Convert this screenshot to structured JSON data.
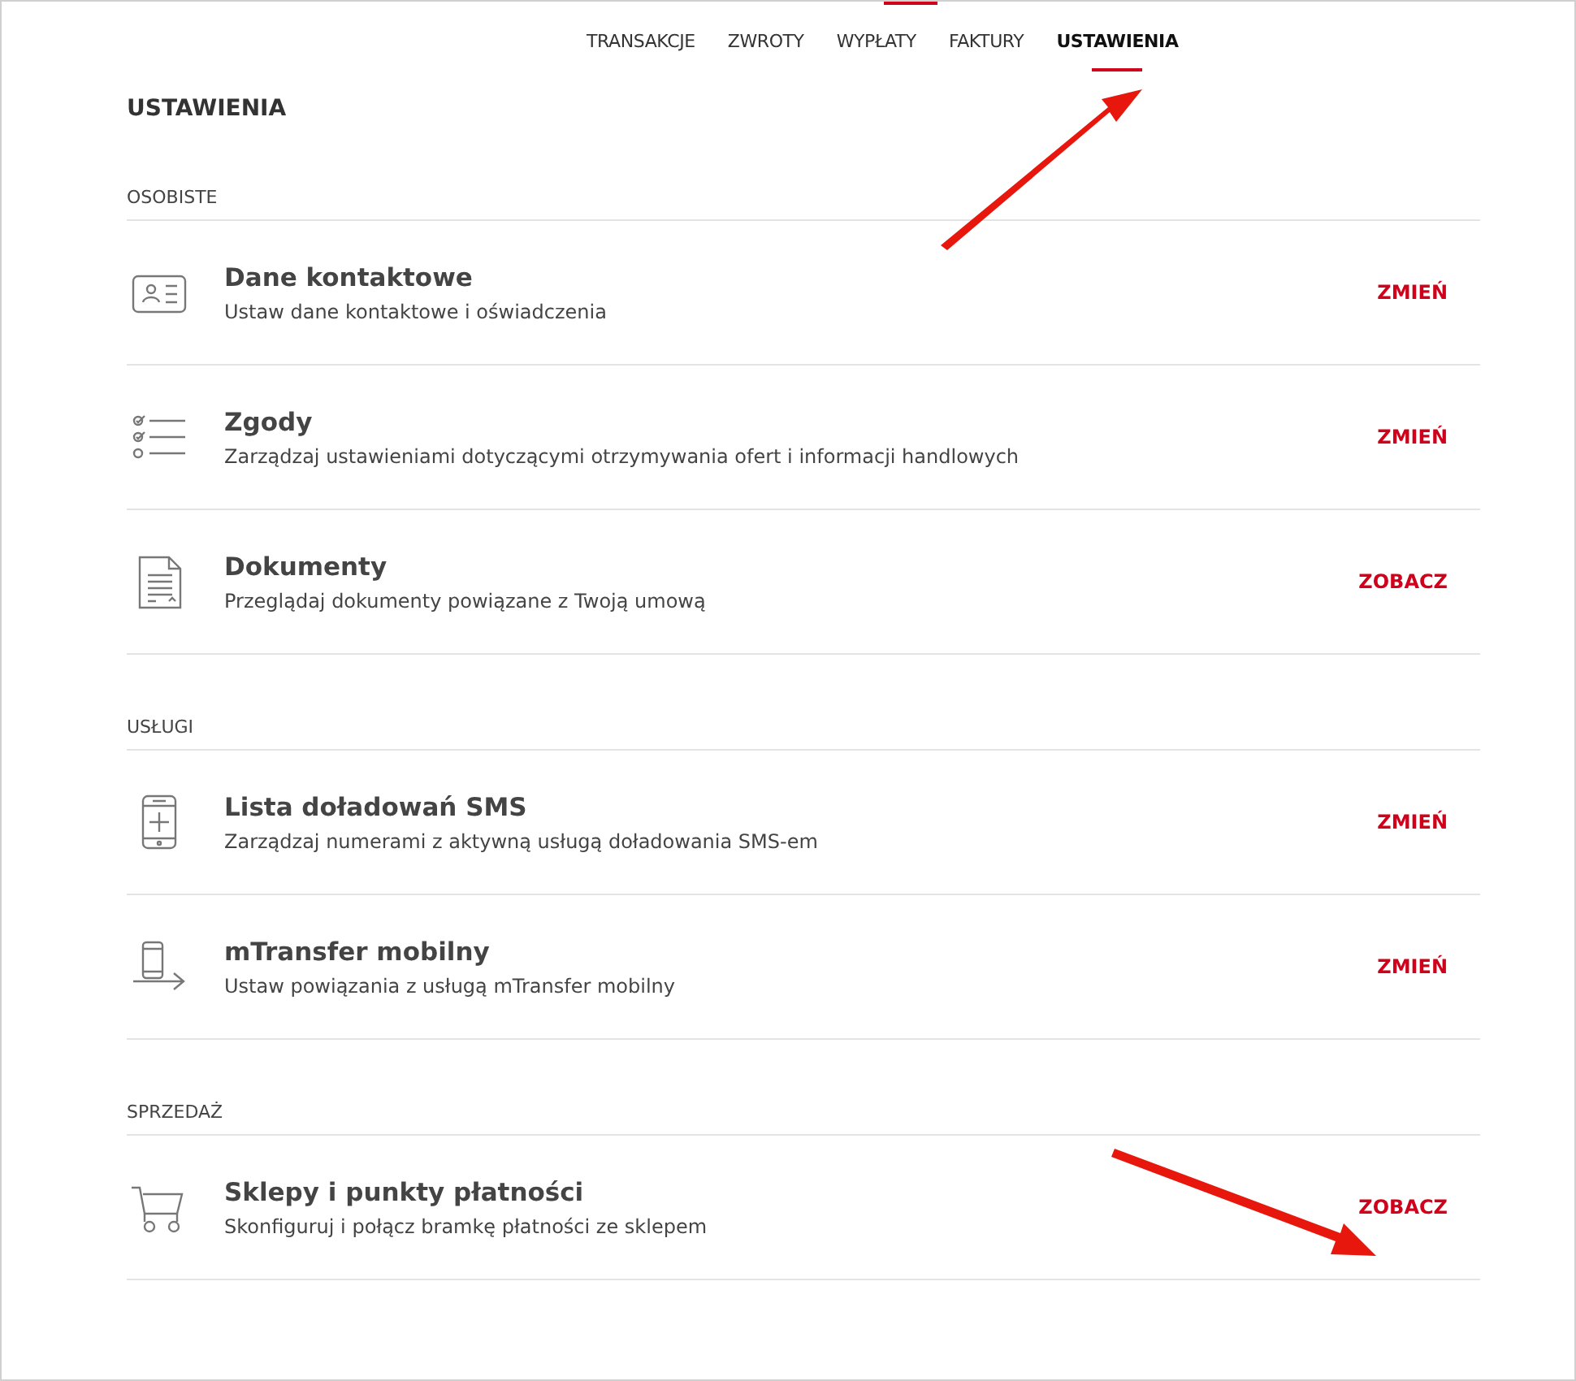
{
  "tabs": [
    {
      "label": "TRANSAKCJE",
      "selected": false
    },
    {
      "label": "ZWROTY",
      "selected": false
    },
    {
      "label": "WYPŁATY",
      "selected": false
    },
    {
      "label": "FAKTURY",
      "selected": false
    },
    {
      "label": "USTAWIENIA",
      "selected": true
    }
  ],
  "page_title": "USTAWIENIA",
  "sections": [
    {
      "heading": "OSOBISTE",
      "items": [
        {
          "kind": "contact",
          "title": "Dane kontaktowe",
          "description": "Ustaw dane kontaktowe i oświadczenia",
          "action": "ZMIEŃ"
        },
        {
          "kind": "consents",
          "title": "Zgody",
          "description": "Zarządzaj ustawieniami dotyczącymi otrzymywania ofert i informacji handlowych",
          "action": "ZMIEŃ"
        },
        {
          "kind": "document",
          "title": "Dokumenty",
          "description": "Przeglądaj dokumenty powiązane z Twoją umową",
          "action": "ZOBACZ"
        }
      ]
    },
    {
      "heading": "USŁUGI",
      "items": [
        {
          "kind": "phone-plus",
          "title": "Lista doładowań SMS",
          "description": "Zarządzaj numerami z aktywną usługą doładowania SMS-em",
          "action": "ZMIEŃ"
        },
        {
          "kind": "phone-transfer",
          "title": "mTransfer mobilny",
          "description": "Ustaw powiązania z usługą mTransfer mobilny",
          "action": "ZMIEŃ"
        }
      ]
    },
    {
      "heading": "SPRZEDAŻ",
      "items": [
        {
          "kind": "cart",
          "title": "Sklepy i punkty płatności",
          "description": "Skonfiguruj i połącz bramkę płatności ze sklepem",
          "action": "ZOBACZ"
        }
      ]
    }
  ]
}
